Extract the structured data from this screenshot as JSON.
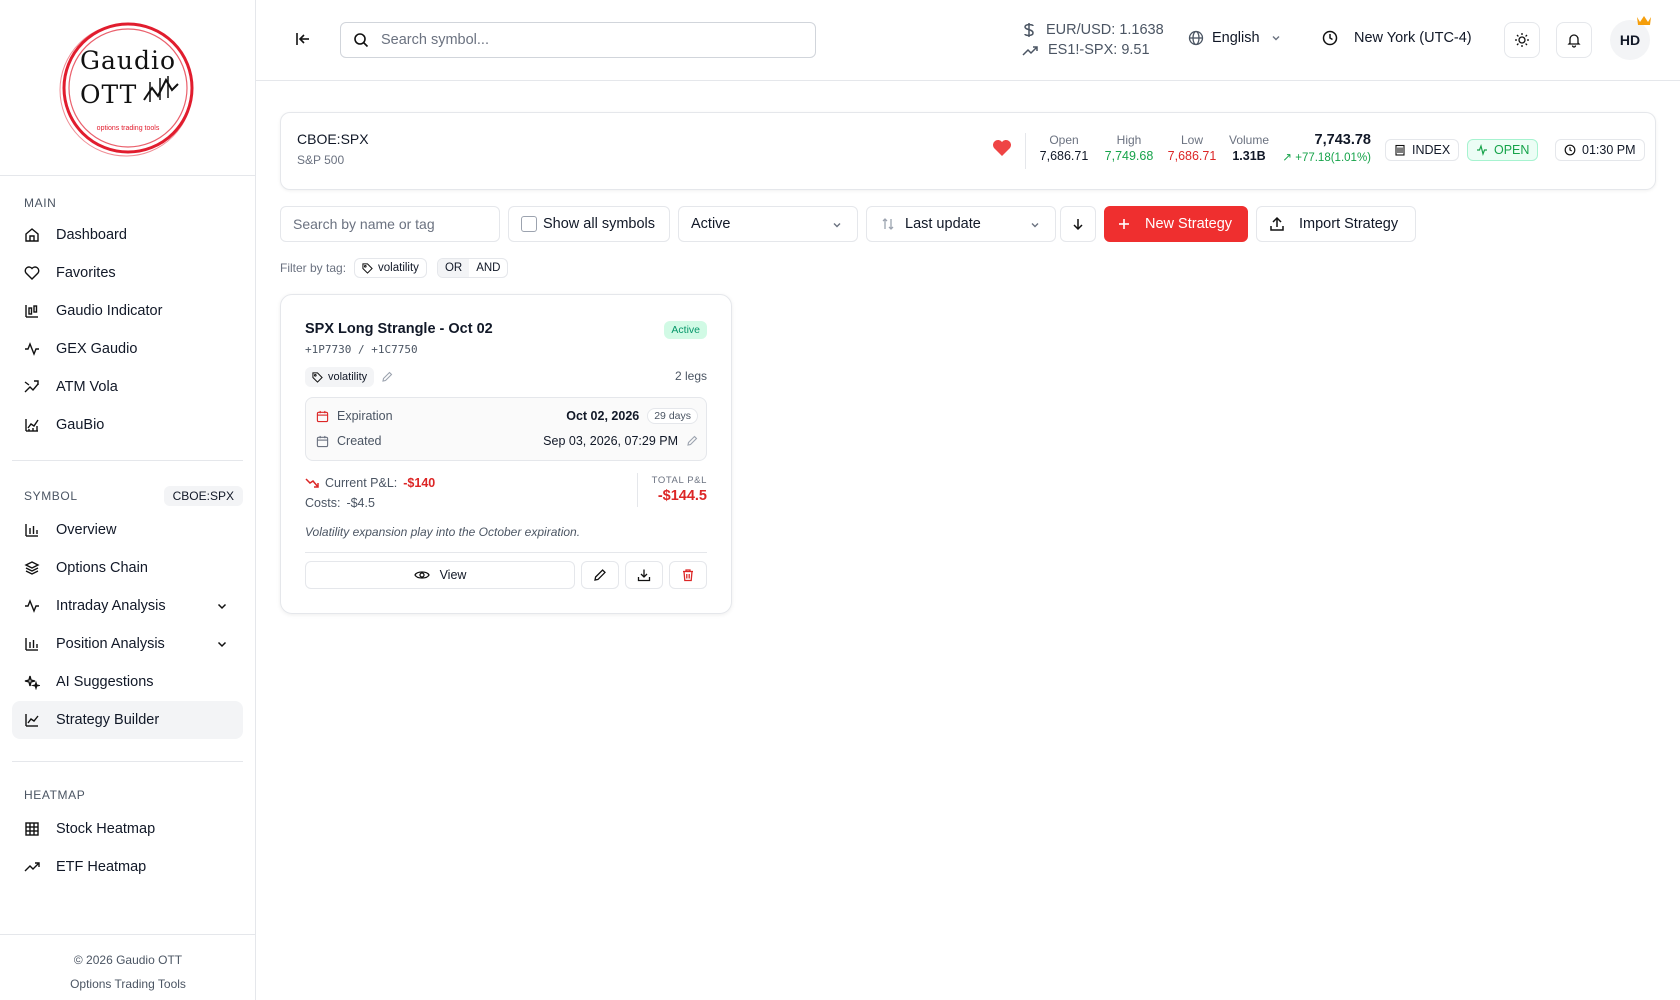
{
  "brand": {
    "logo_line1": "Gaudio",
    "logo_line2": "OTT",
    "logo_tagline": "options trading tools"
  },
  "sidebar": {
    "main_label": "MAIN",
    "main_items": [
      {
        "label": "Dashboard",
        "icon": "home-icon"
      },
      {
        "label": "Favorites",
        "icon": "heart-icon"
      },
      {
        "label": "Gaudio Indicator",
        "icon": "candles-icon"
      },
      {
        "label": "GEX Gaudio",
        "icon": "activity-icon"
      },
      {
        "label": "ATM Vola",
        "icon": "trend-icon"
      },
      {
        "label": "GauBio",
        "icon": "chart-line-icon"
      }
    ],
    "symbol_label": "SYMBOL",
    "symbol_badge": "CBOE:SPX",
    "symbol_items": [
      {
        "label": "Overview",
        "icon": "bar-chart-icon"
      },
      {
        "label": "Options Chain",
        "icon": "layers-icon"
      },
      {
        "label": "Intraday Analysis",
        "icon": "activity-icon",
        "expandable": true
      },
      {
        "label": "Position Analysis",
        "icon": "bar-chart-icon",
        "expandable": true
      },
      {
        "label": "AI Suggestions",
        "icon": "sparkles-icon"
      },
      {
        "label": "Strategy Builder",
        "icon": "line-chart-icon",
        "active": true
      }
    ],
    "heatmap_label": "HEATMAP",
    "heatmap_items": [
      {
        "label": "Stock Heatmap",
        "icon": "grid-icon"
      },
      {
        "label": "ETF Heatmap",
        "icon": "trend-up-icon"
      }
    ],
    "footer_line1": "© 2026 Gaudio OTT",
    "footer_line2": "Options Trading Tools"
  },
  "header": {
    "search_placeholder": "Search symbol...",
    "quote1": "EUR/USD: 1.1638",
    "quote2": "ES1!-SPX: 9.51",
    "language": "English",
    "timezone": "New York (UTC-4)",
    "avatar": "HD"
  },
  "symbol_bar": {
    "symbol": "CBOE:SPX",
    "name": "S&P 500",
    "open_label": "Open",
    "open": "7,686.71",
    "high_label": "High",
    "high": "7,749.68",
    "low_label": "Low",
    "low": "7,686.71",
    "volume_label": "Volume",
    "volume": "1.31B",
    "price": "7,743.78",
    "change": "+77.18(1.01%)",
    "type_badge": "INDEX",
    "status_badge": "OPEN",
    "time": "01:30 PM",
    "colors": {
      "up": "#16a34a",
      "down": "#dc2626",
      "favorite": "#ef4444"
    }
  },
  "toolbar": {
    "search_placeholder": "Search by name or tag",
    "show_all_label": "Show all symbols",
    "status_value": "Active",
    "sort_value": "Last update",
    "new_label": "New Strategy",
    "import_label": "Import Strategy"
  },
  "tag_filter": {
    "label": "Filter by tag:",
    "tag": "volatility",
    "or_label": "OR",
    "and_label": "AND"
  },
  "strategies": [
    {
      "title": "SPX Long Strangle - Oct 02",
      "legs_code": "+1P7730 / +1C7750",
      "status": "Active",
      "tag": "volatility",
      "legs": "2 legs",
      "expiration_label": "Expiration",
      "expiration": "Oct 02, 2026",
      "days": "29 days",
      "created_label": "Created",
      "created": "Sep 03, 2026, 07:29 PM",
      "current_pnl_label": "Current P&L:",
      "current_pnl": "-$140",
      "costs_label": "Costs:",
      "costs": "-$4.5",
      "total_label": "TOTAL P&L",
      "total": "-$144.5",
      "note": "Volatility expansion play into the October expiration.",
      "view_label": "View"
    }
  ]
}
